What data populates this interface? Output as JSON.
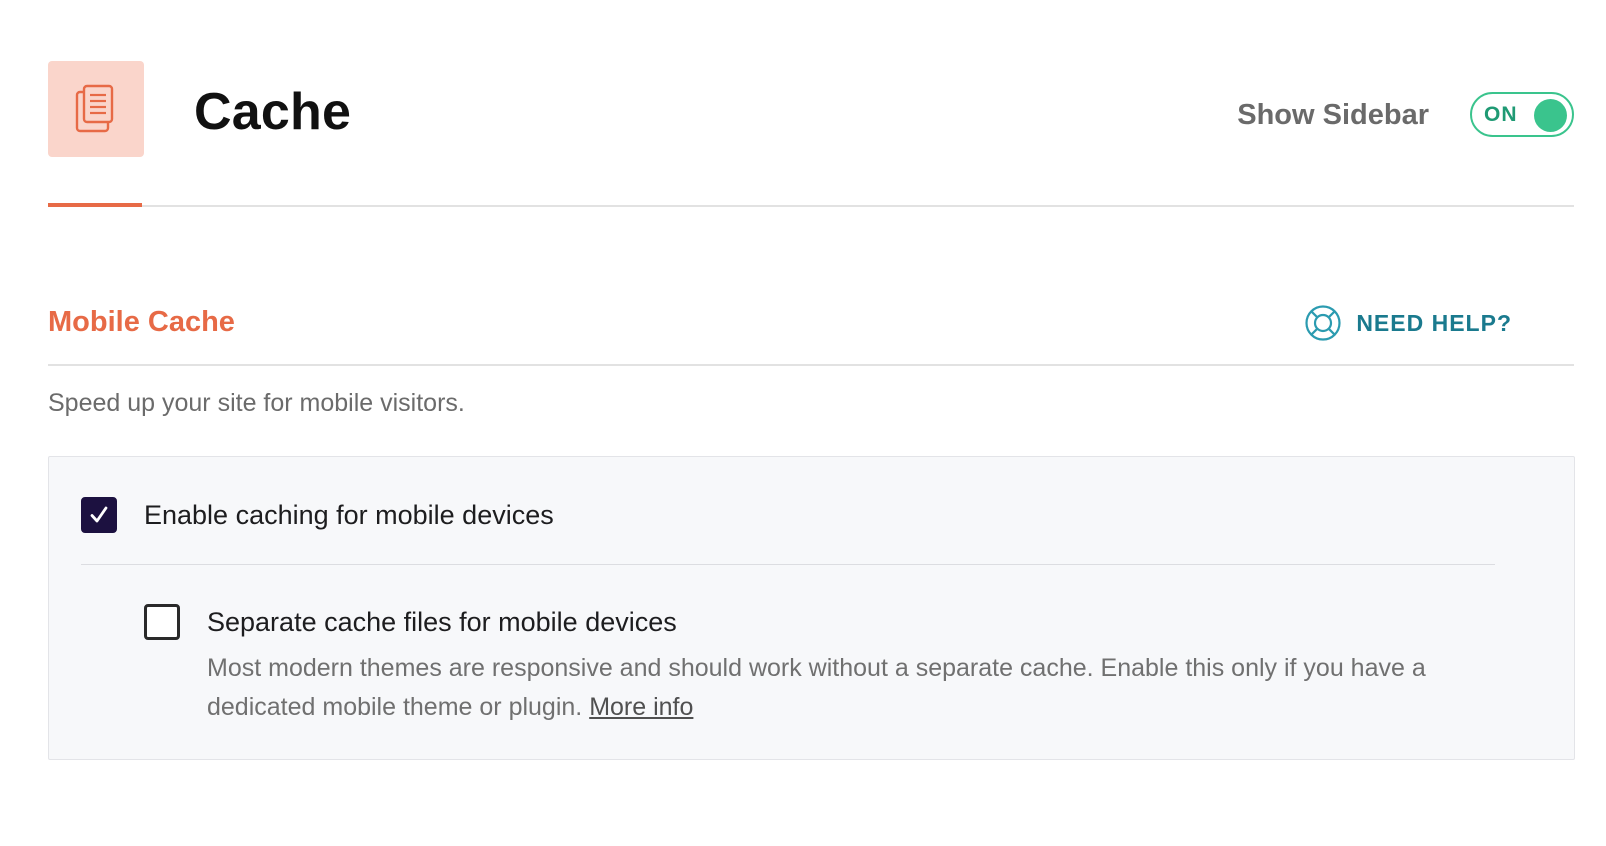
{
  "header": {
    "title": "Cache",
    "page_icon": "document-icon",
    "show_sidebar_label": "Show Sidebar",
    "sidebar_toggle": {
      "state_label": "ON",
      "on": true
    }
  },
  "section": {
    "title": "Mobile Cache",
    "help_label": "NEED HELP?",
    "help_icon": "lifebuoy-icon",
    "description": "Speed up your site for mobile visitors."
  },
  "options": {
    "mobile_caching": {
      "label": "Enable caching for mobile devices",
      "checked": true
    },
    "separate_cache": {
      "label": "Separate cache files for mobile devices",
      "checked": false,
      "help_text": "Most modern themes are responsive and should work without a separate cache. Enable this only if you have a dedicated mobile theme or plugin.",
      "more_info_label": "More info"
    }
  },
  "colors": {
    "accent": "#e76a46",
    "icon_bg": "#fad5cb",
    "toggle_green": "#3ac48d",
    "help_teal": "#1a7a8e",
    "checkbox_checked": "#1c1140",
    "panel_bg": "#f7f8fa"
  }
}
